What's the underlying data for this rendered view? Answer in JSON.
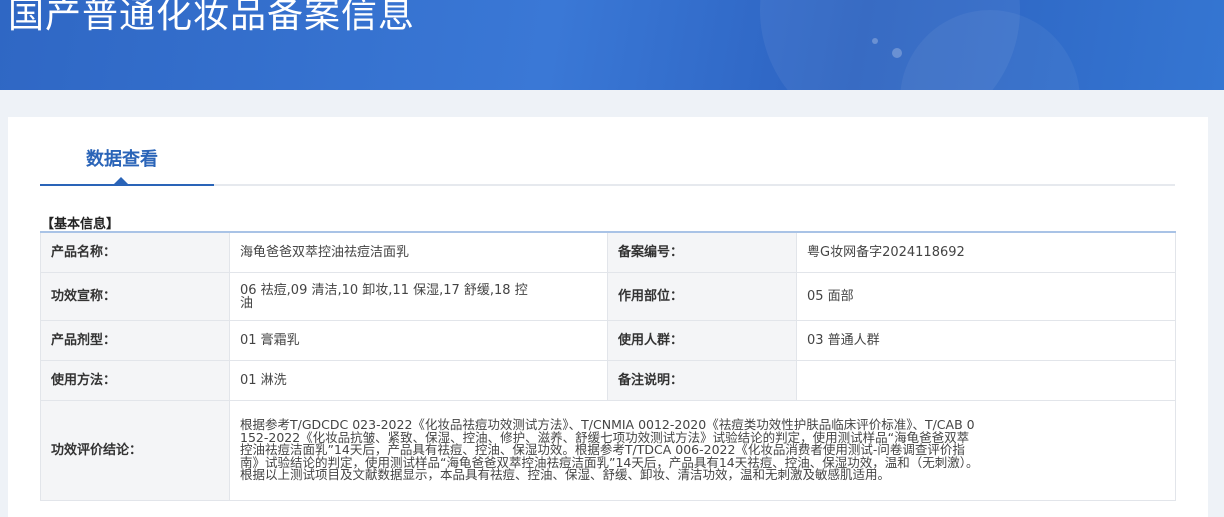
{
  "header": {
    "title": "国产普通化妆品备案信息"
  },
  "tab": {
    "label": "数据查看"
  },
  "section": {
    "title": "【基本信息】"
  },
  "fields": {
    "product_name": {
      "label": "产品名称：",
      "value": "海龟爸爸双萃控油祛痘洁面乳"
    },
    "record_number": {
      "label": "备案编号：",
      "value": "粤G妆网备字2024118692"
    },
    "efficacy_claim": {
      "label": "功效宣称：",
      "value": "06 祛痘,09 清洁,10 卸妆,11 保湿,17 舒缓,18 控油"
    },
    "application_site": {
      "label": "作用部位：",
      "value": "05 面部"
    },
    "dosage_form": {
      "label": "产品剂型：",
      "value": "01 膏霜乳"
    },
    "target_group": {
      "label": "使用人群：",
      "value": "03 普通人群"
    },
    "usage_method": {
      "label": "使用方法：",
      "value": "01 淋洗"
    },
    "remarks": {
      "label": "备注说明：",
      "value": ""
    },
    "efficacy_conclusion": {
      "label": "功效评价结论：",
      "value": "根据参考T/GDCDC 023-2022《化妆品祛痘功效测试方法》、T/CNMIA 0012-2020《祛痘类功效性护肤品临床评价标准》、T/CAB 0152-2022《化妆品抗皱、紧致、保湿、控油、修护、滋养、舒缓七项功效测试方法》试验结论的判定，使用测试样品“海龟爸爸双萃控油祛痘洁面乳”14天后，产品具有祛痘、控油、保湿功效。根据参考T/TDCA 006-2022《化妆品消费者使用测试-问卷调查评价指南》试验结论的判定，使用测试样品“海龟爸爸双萃控油祛痘洁面乳”14天后，产品具有14天祛痘、控油、保湿功效，温和（无刺激）。根据以上测试项目及文献数据显示，本品具有祛痘、控油、保湿、舒缓、卸妆、清洁功效，温和无刺激及敏感肌适用。"
    }
  }
}
